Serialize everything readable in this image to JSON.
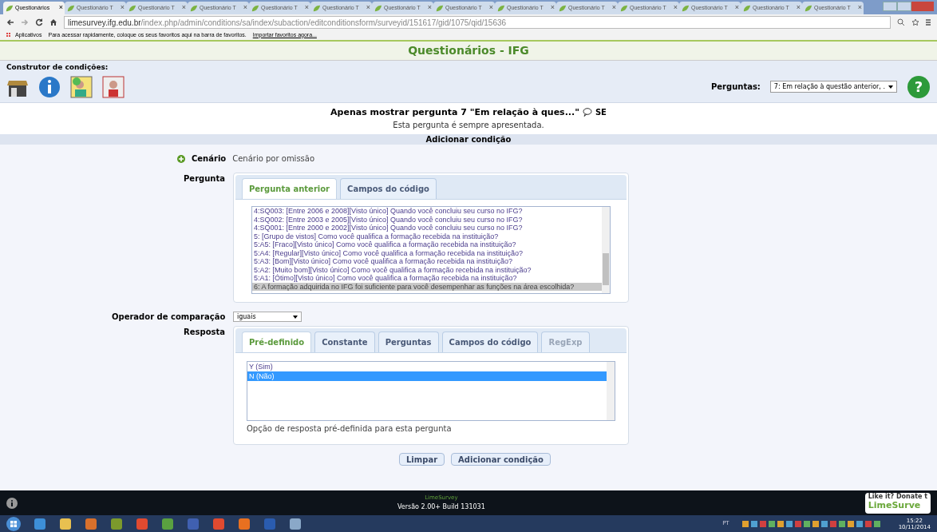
{
  "browser": {
    "tabs": [
      {
        "label": "Questionários",
        "selected": true
      },
      {
        "label": "Questionário T",
        "selected": false
      },
      {
        "label": "Questionário T",
        "selected": false
      },
      {
        "label": "Questionário T",
        "selected": false
      },
      {
        "label": "Questionário T",
        "selected": false
      },
      {
        "label": "Questionário T",
        "selected": false
      },
      {
        "label": "Questionário T",
        "selected": false
      },
      {
        "label": "Questionário T",
        "selected": false
      },
      {
        "label": "Questionário T",
        "selected": false
      },
      {
        "label": "Questionário T",
        "selected": false
      },
      {
        "label": "Questionário T",
        "selected": false
      },
      {
        "label": "Questionário T",
        "selected": false
      },
      {
        "label": "Questionário T",
        "selected": false
      },
      {
        "label": "Questionário T",
        "selected": false
      }
    ],
    "close_glyph": "×",
    "url_host": "limesurvey.ifg.edu.br",
    "url_path": "/index.php/admin/conditions/sa/index/subaction/editconditionsform/surveyid/151617/gid/1075/qid/15636",
    "bookmarks": {
      "apps": "Aplicativos",
      "hint": "Para acessar rapidamente, coloque os seus favoritos aqui na barra de favoritos.",
      "import_link": "Importar favoritos agora..."
    }
  },
  "page_title": "Questionários - IFG",
  "toolbar": {
    "label": "Construtor de condições:",
    "questions_label": "Perguntas:",
    "questions_value": "7: Em relação à questão anterior, .",
    "help_glyph": "?"
  },
  "summary": {
    "heading": "Apenas mostrar pergunta 7 \"Em relação à ques...\"",
    "tag": "SE",
    "note": "Esta pergunta é sempre apresentada."
  },
  "section_title": "Adicionar condição",
  "scenario": {
    "label": "Cenário",
    "value": "Cenário por omissão"
  },
  "question": {
    "label": "Pergunta",
    "tabs": [
      {
        "label": "Pergunta anterior",
        "selected": true,
        "disabled": false
      },
      {
        "label": "Campos do código",
        "selected": false,
        "disabled": false
      }
    ],
    "options": [
      {
        "text": "4:SQ003: [Entre 2006 e 2008][Visto único] Quando você concluiu seu curso no IFG?",
        "selected": false
      },
      {
        "text": "4:SQ002: [Entre 2003 e 2005][Visto único] Quando você concluiu seu curso no IFG?",
        "selected": false
      },
      {
        "text": "4:SQ001: [Entre 2000 e 2002][Visto único] Quando você concluiu seu curso no IFG?",
        "selected": false
      },
      {
        "text": "5: [Grupo de vistos] Como você qualifica a formação recebida na instituição?",
        "selected": false
      },
      {
        "text": "5:A5: [Fraco][Visto único] Como você qualifica a formação recebida na instituição?",
        "selected": false
      },
      {
        "text": "5:A4: [Regular][Visto único] Como você qualifica a formação recebida na instituição?",
        "selected": false
      },
      {
        "text": "5:A3: [Bom][Visto único] Como você qualifica a formação recebida na instituição?",
        "selected": false
      },
      {
        "text": "5:A2: [Muito bom][Visto único] Como você qualifica a formação recebida na instituição?",
        "selected": false
      },
      {
        "text": "5:A1: [Ótimo][Visto único] Como você qualifica a formação recebida na instituição?",
        "selected": false
      },
      {
        "text": "6: A formação adquirida no IFG foi suficiente para você desempenhar as funções na área escolhida?",
        "selected": true
      }
    ]
  },
  "operator": {
    "label": "Operador de comparação",
    "value": "iguais"
  },
  "answer": {
    "label": "Resposta",
    "tabs": [
      {
        "label": "Pré-definido",
        "selected": true,
        "disabled": false
      },
      {
        "label": "Constante",
        "selected": false,
        "disabled": false
      },
      {
        "label": "Perguntas",
        "selected": false,
        "disabled": false
      },
      {
        "label": "Campos do código",
        "selected": false,
        "disabled": false
      },
      {
        "label": "RegExp",
        "selected": false,
        "disabled": true
      }
    ],
    "options": [
      {
        "text": "Y (Sim)",
        "selected": false
      },
      {
        "text": "N (Não)",
        "selected": true
      }
    ],
    "help": "Opção de resposta pré-definida para esta pergunta"
  },
  "buttons": [
    "Limpar",
    "Adicionar condição"
  ],
  "footer": {
    "brand": "LimeSurvey",
    "version": "Versão 2.00+ Build 131031",
    "donate_top": "Like it? Donate t",
    "donate_brand": "LimeSurve"
  },
  "taskbar": {
    "lang": "PT",
    "time": "15:22",
    "date": "10/11/2014"
  }
}
